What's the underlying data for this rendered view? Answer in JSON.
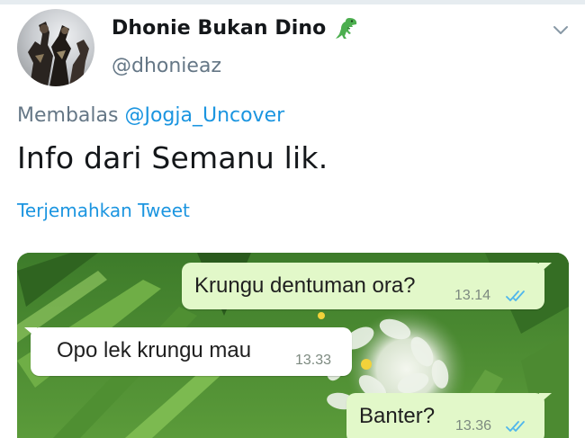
{
  "header": {
    "display_name": "Dhonie Bukan Dino",
    "name_emoji_icon": "t-rex-dinosaur-emoji",
    "handle": "@dhonieaz",
    "menu_icon": "chevron-down-icon"
  },
  "reply": {
    "prefix": "Membalas",
    "mention": "@Jogja_Uncover"
  },
  "tweet": {
    "text": "Info dari Semanu lik.",
    "translate_label": "Terjemahkan Tweet"
  },
  "chat_image": {
    "messages": [
      {
        "direction": "outgoing",
        "text": "Krungu dentuman ora?",
        "time": "13.14",
        "read": true
      },
      {
        "direction": "incoming",
        "text": "Opo lek krungu mau",
        "time": "13.33"
      },
      {
        "direction": "outgoing",
        "text": "Banter?",
        "time": "13.36",
        "read": true
      }
    ]
  },
  "colors": {
    "link": "#1b95e0",
    "secondary_text": "#657786",
    "outgoing_bubble": "#e2f8c9",
    "read_ticks": "#4fb6ec"
  }
}
